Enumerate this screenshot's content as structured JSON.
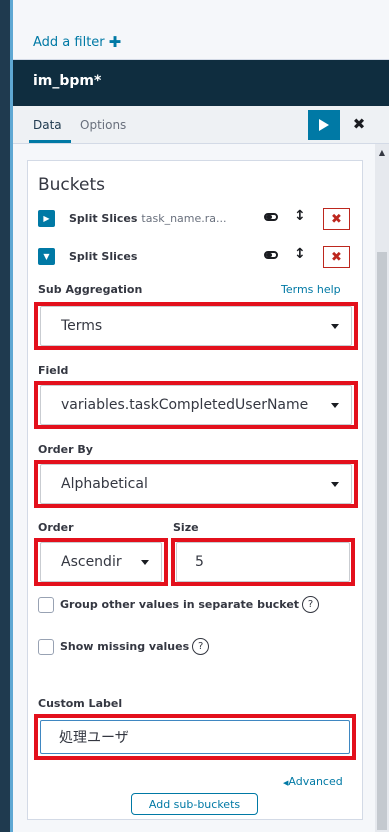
{
  "filter_bar": {
    "add_filter_label": "Add a filter"
  },
  "index": {
    "title": "im_bpm*"
  },
  "tabs": [
    {
      "label": "Data"
    },
    {
      "label": "Options"
    }
  ],
  "buckets": {
    "title": "Buckets",
    "aggs": [
      {
        "label": "Split Slices",
        "description": "task_name.ra..."
      },
      {
        "label": "Split Slices",
        "description": ""
      }
    ]
  },
  "sub_aggregation": {
    "label": "Sub Aggregation",
    "help_link": "Terms help",
    "value": "Terms"
  },
  "field": {
    "label": "Field",
    "value": "variables.taskCompletedUserName"
  },
  "order_by": {
    "label": "Order By",
    "value": "Alphabetical"
  },
  "order": {
    "label": "Order",
    "value": "Ascendir"
  },
  "size": {
    "label": "Size",
    "value": "5"
  },
  "options": {
    "group_other": "Group other values in separate bucket",
    "show_missing": "Show missing values"
  },
  "custom_label": {
    "label": "Custom Label",
    "value": "処理ユーザ"
  },
  "advanced_link": "Advanced",
  "add_sub_buckets": "Add sub-buckets",
  "colors": {
    "accent": "#0079a5",
    "header": "#0f2d3f",
    "highlight": "#e3101c",
    "danger": "#bd271e"
  }
}
